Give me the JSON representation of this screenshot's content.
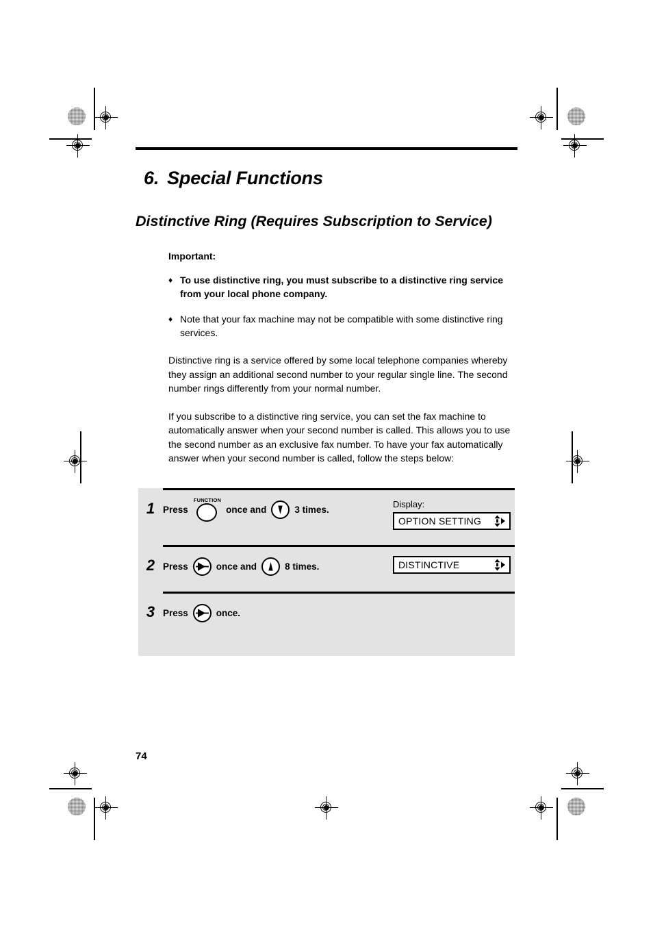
{
  "document": {
    "chapter_number": "6.",
    "chapter_title": "Special Functions",
    "section_title": "Distinctive Ring (Requires Subscription to Service)",
    "page_number": "74"
  },
  "important": {
    "label": "Important:",
    "bullet_marker": "♦",
    "bullets": [
      {
        "bold": true,
        "text": "To use distinctive ring, you must subscribe to a distinctive ring service from your local phone company."
      },
      {
        "bold": false,
        "text": "Note that your fax machine may not be compatible with some distinctive ring services."
      }
    ]
  },
  "paragraphs": [
    "Distinctive ring is a service offered by some local telephone companies whereby they assign an additional second number to your regular single line. The second number rings differently from your normal number.",
    "If you subscribe to a distinctive ring service, you can set the fax machine to automatically answer when your second number is called. This allows you to use the second number as an exclusive fax number. To have your fax automatically answer when your second number is called, follow the steps below:"
  ],
  "steps": {
    "display_label": "Display:",
    "rows": [
      {
        "number": "1",
        "press_label": "Press",
        "key1": "function-key",
        "key1_caption": "FUNCTION",
        "mid_text": "once and",
        "key2": "down-arrow-key",
        "count_text": "3 times.",
        "display_value": "OPTION SETTING"
      },
      {
        "number": "2",
        "press_label": "Press",
        "key1": "right-arrow-key",
        "key1_caption": "",
        "mid_text": "once and",
        "key2": "up-arrow-key",
        "count_text": "8 times.",
        "display_value": "DISTINCTIVE"
      },
      {
        "number": "3",
        "press_label": "Press",
        "key1": "right-arrow-key",
        "key1_caption": "",
        "mid_text": "once.",
        "key2": "",
        "count_text": "",
        "display_value": ""
      }
    ]
  },
  "colors": {
    "table_background": "#e3e3e3",
    "rule": "#000000",
    "page_background": "#ffffff"
  }
}
